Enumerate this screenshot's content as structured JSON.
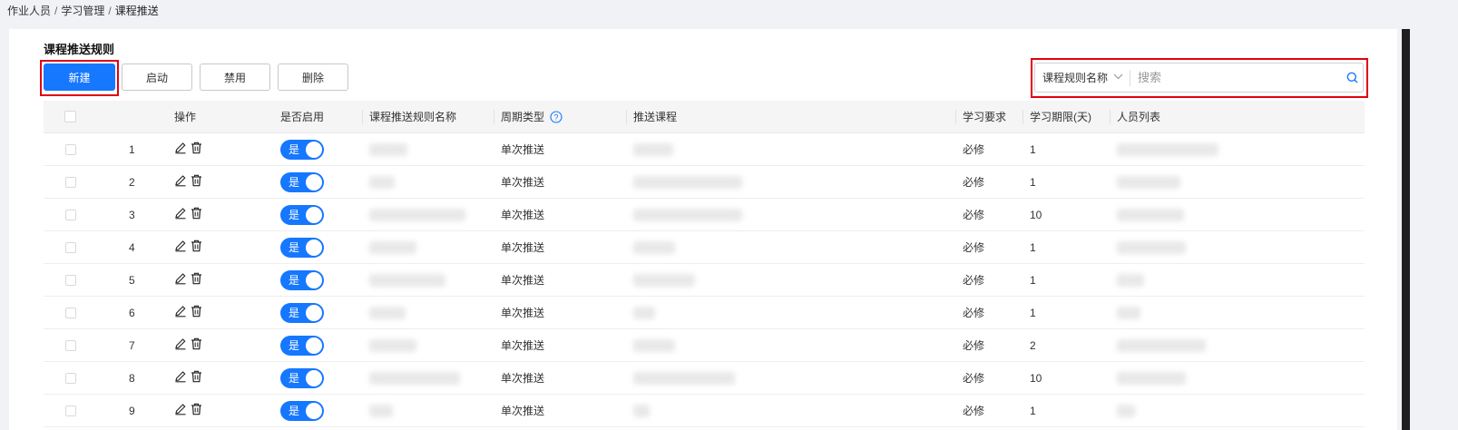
{
  "breadcrumb": {
    "item1": "作业人员",
    "item2": "学习管理",
    "item3": "课程推送",
    "separator": "/"
  },
  "section_title": "课程推送规则",
  "toolbar": {
    "new_label": "新建",
    "enable_label": "启动",
    "disable_label": "禁用",
    "delete_label": "删除"
  },
  "search": {
    "field_label": "课程规则名称",
    "placeholder": "搜索"
  },
  "table": {
    "headers": {
      "action": "操作",
      "enabled": "是否启用",
      "rule_name": "课程推送规则名称",
      "cycle_type": "周期类型",
      "course": "推送课程",
      "requirement": "学习要求",
      "period": "学习期限(天)",
      "people": "人员列表"
    },
    "rows": [
      {
        "index": "1",
        "toggle": "是",
        "cycle_type": "单次推送",
        "requirement": "必修",
        "period": "1"
      },
      {
        "index": "2",
        "toggle": "是",
        "cycle_type": "单次推送",
        "requirement": "必修",
        "period": "1"
      },
      {
        "index": "3",
        "toggle": "是",
        "cycle_type": "单次推送",
        "requirement": "必修",
        "period": "10"
      },
      {
        "index": "4",
        "toggle": "是",
        "cycle_type": "单次推送",
        "requirement": "必修",
        "period": "1"
      },
      {
        "index": "5",
        "toggle": "是",
        "cycle_type": "单次推送",
        "requirement": "必修",
        "period": "1"
      },
      {
        "index": "6",
        "toggle": "是",
        "cycle_type": "单次推送",
        "requirement": "必修",
        "period": "1"
      },
      {
        "index": "7",
        "toggle": "是",
        "cycle_type": "单次推送",
        "requirement": "必修",
        "period": "2"
      },
      {
        "index": "8",
        "toggle": "是",
        "cycle_type": "单次推送",
        "requirement": "必修",
        "period": "10"
      },
      {
        "index": "9",
        "toggle": "是",
        "cycle_type": "单次推送",
        "requirement": "必修",
        "period": "1"
      }
    ]
  },
  "colors": {
    "primary": "#1677ff",
    "highlight": "#e3000f"
  },
  "icons": {
    "edit": "edit-icon",
    "delete": "trash-icon",
    "help": "help-icon",
    "search": "search-icon",
    "chevron": "chevron-down-icon"
  }
}
